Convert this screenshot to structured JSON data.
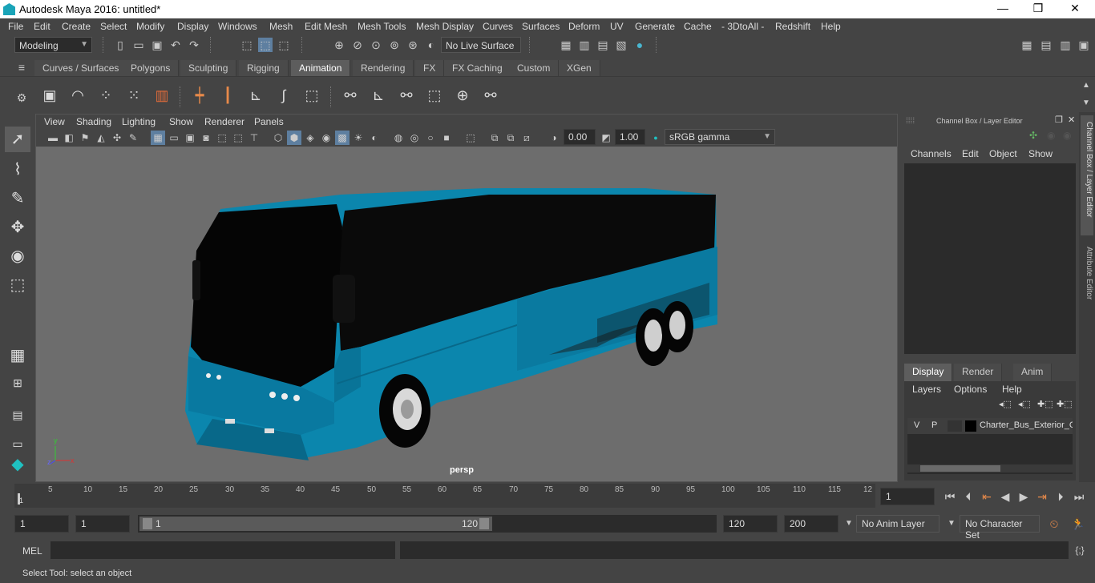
{
  "window": {
    "title": "Autodesk Maya 2016: untitled*",
    "min": "—",
    "max": "❒",
    "close": "✕"
  },
  "menu": [
    "File",
    "Edit",
    "Create",
    "Select",
    "Modify",
    "Display",
    "Windows",
    "Mesh",
    "Edit Mesh",
    "Mesh Tools",
    "Mesh Display",
    "Curves",
    "Surfaces",
    "Deform",
    "UV",
    "Generate",
    "Cache",
    "- 3DtoAll -",
    "Redshift",
    "Help"
  ],
  "toolbar": {
    "mode": "Modeling",
    "live_surface": "No Live Surface"
  },
  "shelf_tabs": [
    "Curves / Surfaces",
    "Polygons",
    "Sculpting",
    "Rigging",
    "Animation",
    "Rendering",
    "FX",
    "FX Caching",
    "Custom",
    "XGen"
  ],
  "shelf_active": "Animation",
  "viewport": {
    "menu": [
      "View",
      "Shading",
      "Lighting",
      "Show",
      "Renderer",
      "Panels"
    ],
    "exposure": "0.00",
    "gamma": "1.00",
    "color_space": "sRGB gamma",
    "camera_label": "persp",
    "axis_x": "x",
    "axis_y": "y",
    "axis_z": "z"
  },
  "channel_box": {
    "title": "Channel Box / Layer Editor",
    "menu": [
      "Channels",
      "Edit",
      "Object",
      "Show"
    ],
    "side_tabs": [
      "Channel Box / Layer Editor",
      "Attribute Editor"
    ]
  },
  "layer_editor": {
    "tabs": [
      "Display",
      "Render",
      "Anim"
    ],
    "active_tab": "Display",
    "menu": [
      "Layers",
      "Options",
      "Help"
    ],
    "layer": {
      "v": "V",
      "p": "P",
      "name": "Charter_Bus_Exterior_C"
    }
  },
  "timeline": {
    "ticks": [
      "5",
      "10",
      "15",
      "20",
      "25",
      "30",
      "35",
      "40",
      "45",
      "50",
      "55",
      "60",
      "65",
      "70",
      "75",
      "80",
      "85",
      "90",
      "95",
      "100",
      "105",
      "110",
      "115",
      "12"
    ],
    "start_marker": "1",
    "current_frame": "1"
  },
  "range": {
    "start": "1",
    "anim_start": "1",
    "slider_start": "1",
    "slider_end": "120",
    "end": "120",
    "anim_end": "200",
    "anim_layer": "No Anim Layer",
    "character_set": "No Character Set"
  },
  "command": {
    "label": "MEL"
  },
  "help_line": "Select Tool: select an object",
  "colors": {
    "bus": "#0b86ad",
    "viewport_bg": "#6d6d6d",
    "accent": "#5d5d5d"
  }
}
